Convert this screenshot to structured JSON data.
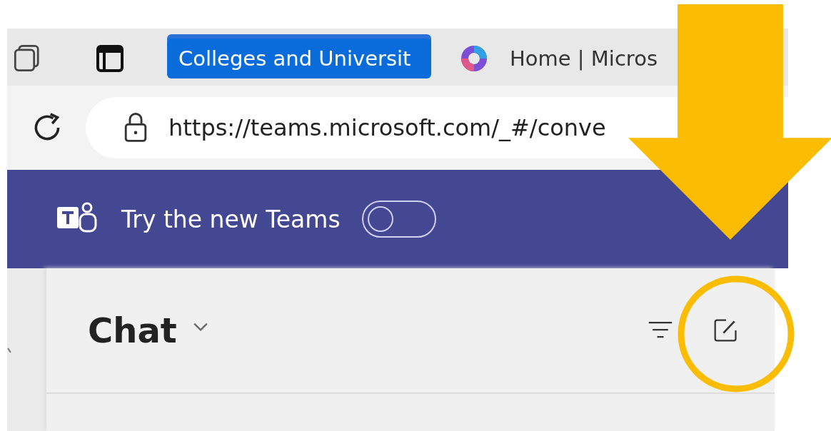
{
  "browser": {
    "tabs": [
      {
        "label": "Colleges and Universit",
        "selected": true
      },
      {
        "label": "Home | Micros",
        "selected": false
      }
    ],
    "address": "https://teams.microsoft.com/_#/conve"
  },
  "banner": {
    "label": "Try the new Teams",
    "toggle": {
      "on": false
    }
  },
  "chat": {
    "title": "Chat"
  }
}
